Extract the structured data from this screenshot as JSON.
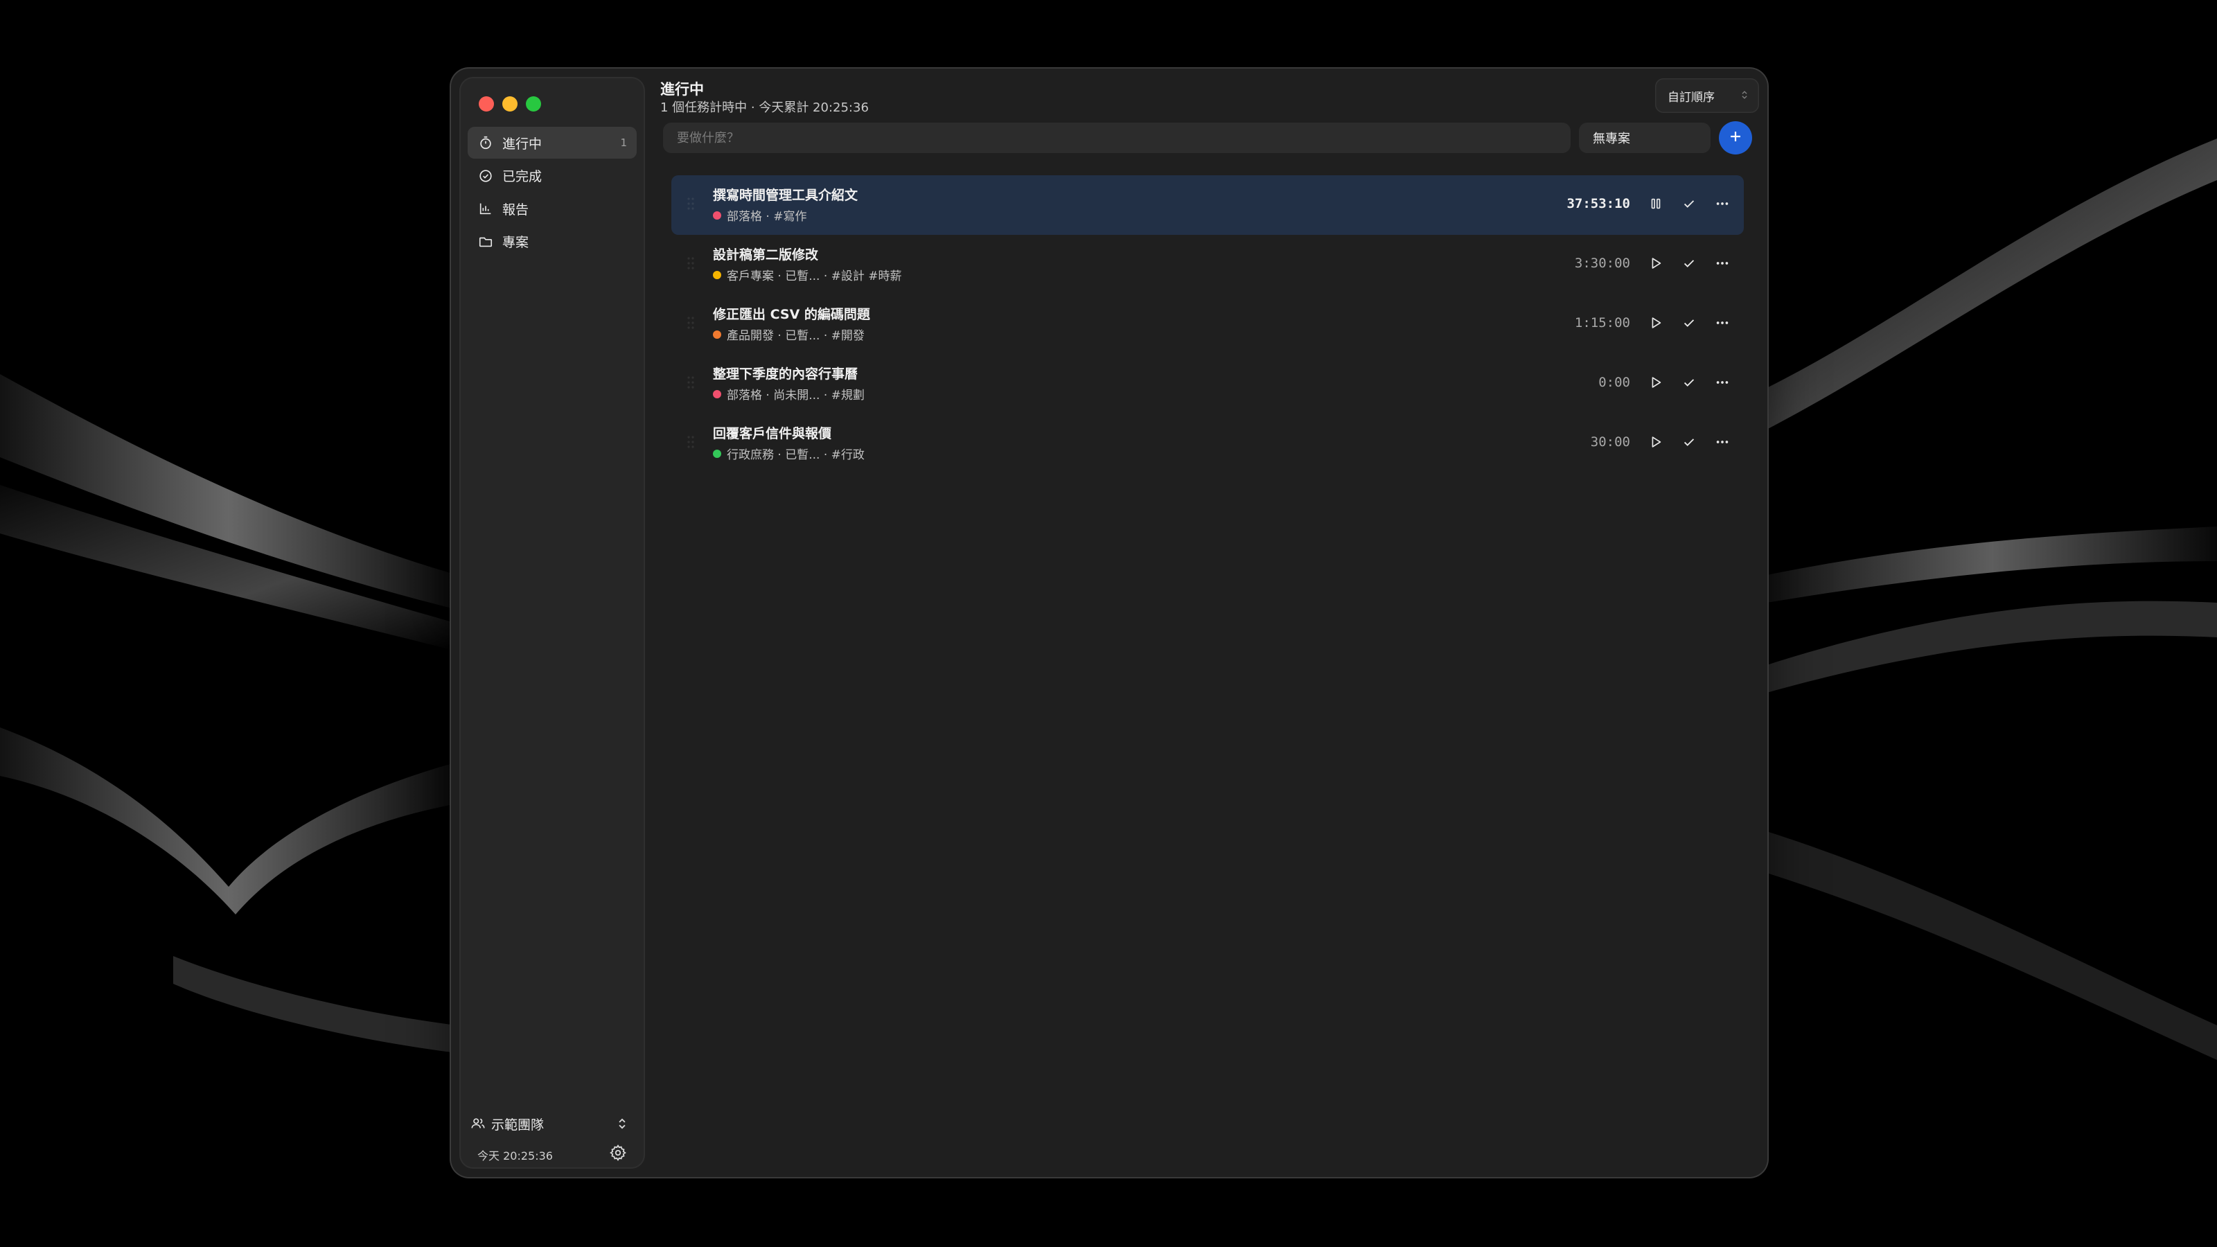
{
  "sidebar": {
    "items": [
      {
        "label": "進行中",
        "count": "1",
        "icon": "timer-icon"
      },
      {
        "label": "已完成",
        "count": "",
        "icon": "check-circle-icon"
      },
      {
        "label": "報告",
        "count": "",
        "icon": "bar-chart-icon"
      },
      {
        "label": "專案",
        "count": "",
        "icon": "folder-icon"
      }
    ],
    "team_label": "示範團隊",
    "today_total": "今天 20:25:36"
  },
  "header": {
    "title": "進行中",
    "subtitle": "1 個任務計時中 · 今天累計 20:25:36",
    "sort_label": "自訂順序"
  },
  "composer": {
    "placeholder": "要做什麼？",
    "project_select": "無專案"
  },
  "tasks": [
    {
      "title": "撰寫時間管理工具介紹文",
      "dot_color": "#f0506e",
      "meta": "部落格 · #寫作",
      "time": "37:53:10",
      "state": "running"
    },
    {
      "title": "設計稿第二版修改",
      "dot_color": "#f5b400",
      "meta": "客戶專案 · 已暫... · #設計 #時薪",
      "time": "3:30:00",
      "state": "paused"
    },
    {
      "title": "修正匯出 CSV 的編碼問題",
      "dot_color": "#f07a30",
      "meta": "產品開發 · 已暫... · #開發",
      "time": "1:15:00",
      "state": "paused"
    },
    {
      "title": "整理下季度的內容行事曆",
      "dot_color": "#f0506e",
      "meta": "部落格 · 尚未開... · #規劃",
      "time": "0:00",
      "state": "idle"
    },
    {
      "title": "回覆客戶信件與報價",
      "dot_color": "#34c759",
      "meta": "行政庶務 · 已暫... · #行政",
      "time": "30:00",
      "state": "paused"
    }
  ],
  "colors": {
    "accent": "#1f5fd6",
    "active_row": "#223046",
    "window_bg": "#1f1f1f",
    "sidebar_bg": "#262626"
  }
}
